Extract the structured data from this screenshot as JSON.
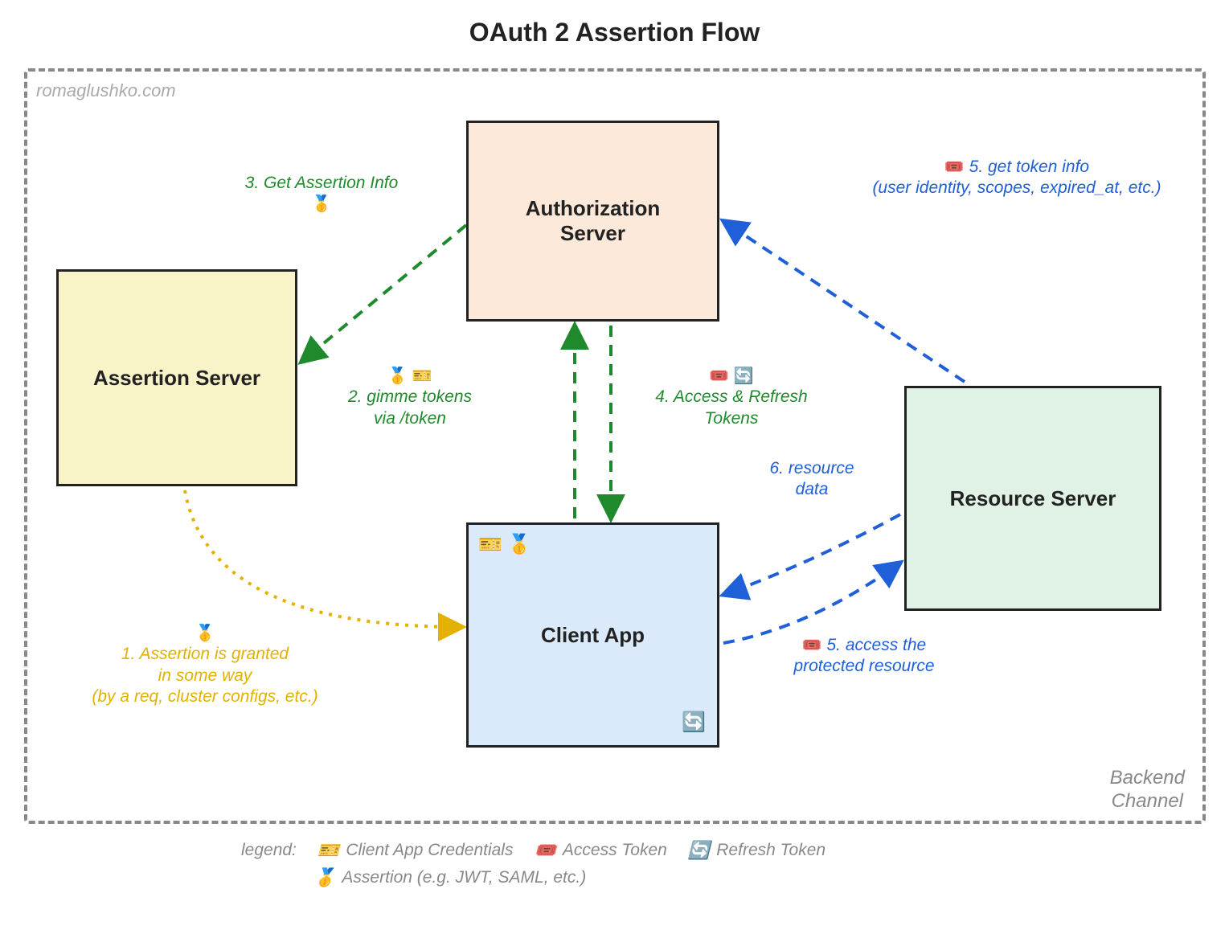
{
  "title": "OAuth 2 Assertion Flow",
  "watermark": "romaglushko.com",
  "channel_label": "Backend\nChannel",
  "nodes": {
    "auth": "Authorization\nServer",
    "assertion": "Assertion Server",
    "client": "Client App",
    "resource": "Resource Server"
  },
  "steps": {
    "s1": "1. Assertion is granted\nin some way\n(by a req, cluster configs, etc.)",
    "s2": "2. gimme tokens\nvia /token",
    "s3": "3. Get Assertion Info",
    "s4": "4. Access & Refresh\nTokens",
    "s5a": "5. access the\nprotected resource",
    "s5b": "5. get token info\n(user identity, scopes, expired_at, etc.)",
    "s6": "6. resource\ndata"
  },
  "legend": {
    "label": "legend:",
    "client_creds": "Client App Credentials",
    "access_token": "Access Token",
    "refresh_token": "Refresh Token",
    "assertion": "Assertion (e.g. JWT, SAML, etc.)"
  },
  "icons": {
    "medal": "🥇",
    "ticket_yellow": "🎫",
    "ticket_pink": "🎟️",
    "refresh": "🔄"
  }
}
